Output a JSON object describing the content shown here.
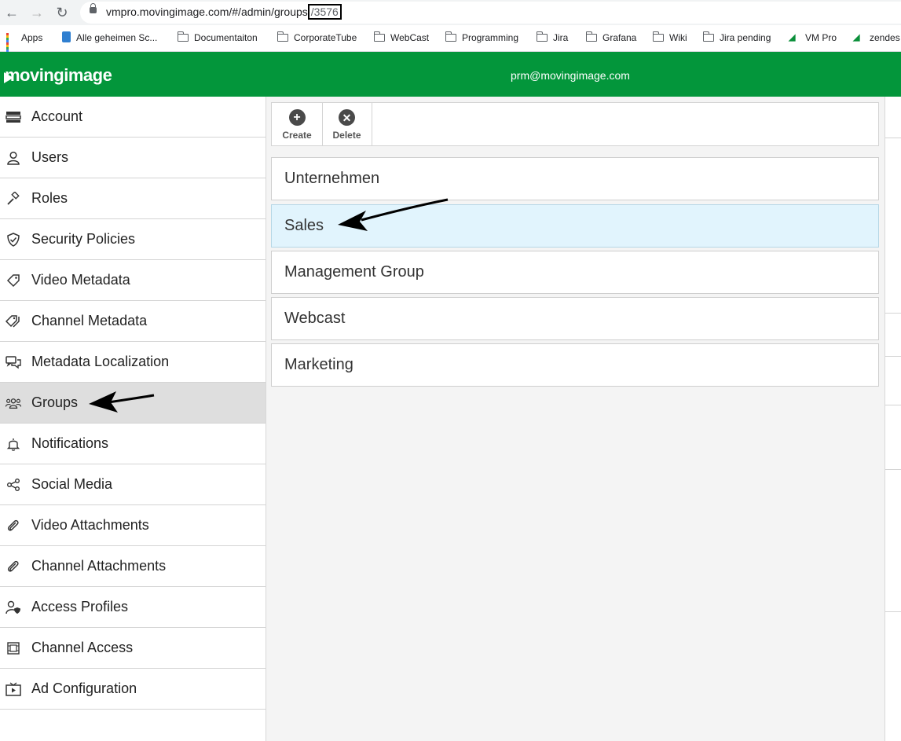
{
  "browser": {
    "url_prefix": "vmpro.movingimage.com/#/admin/groups",
    "url_id": "/3576",
    "bookmarks": [
      {
        "label": "Apps",
        "icon": "apps-grid-icon"
      },
      {
        "label": "Alle geheimen Sc...",
        "icon": "lock-icon"
      },
      {
        "label": "Documentaiton",
        "icon": "folder-icon"
      },
      {
        "label": "CorporateTube",
        "icon": "folder-icon"
      },
      {
        "label": "WebCast",
        "icon": "folder-icon"
      },
      {
        "label": "Programming",
        "icon": "folder-icon"
      },
      {
        "label": "Jira",
        "icon": "folder-icon"
      },
      {
        "label": "Grafana",
        "icon": "folder-icon"
      },
      {
        "label": "Wiki",
        "icon": "folder-icon"
      },
      {
        "label": "Jira pending",
        "icon": "folder-icon"
      },
      {
        "label": "VM Pro",
        "icon": "vmpro-icon"
      },
      {
        "label": "zendes",
        "icon": "vmpro-icon"
      }
    ]
  },
  "header": {
    "logo_text": "movingimage",
    "user_email": "prm@movingimage.com",
    "brand_color": "#03963b"
  },
  "sidebar": {
    "items": [
      {
        "label": "Account",
        "icon": "server-icon"
      },
      {
        "label": "Users",
        "icon": "user-icon"
      },
      {
        "label": "Roles",
        "icon": "gavel-icon"
      },
      {
        "label": "Security Policies",
        "icon": "shield-icon"
      },
      {
        "label": "Video Metadata",
        "icon": "tag-icon"
      },
      {
        "label": "Channel Metadata",
        "icon": "tags-icon"
      },
      {
        "label": "Metadata Localization",
        "icon": "comments-icon"
      },
      {
        "label": "Groups",
        "icon": "group-icon",
        "active": true
      },
      {
        "label": "Notifications",
        "icon": "bell-icon"
      },
      {
        "label": "Social Media",
        "icon": "share-icon"
      },
      {
        "label": "Video Attachments",
        "icon": "paperclip-icon"
      },
      {
        "label": "Channel Attachments",
        "icon": "paperclip-icon"
      },
      {
        "label": "Access Profiles",
        "icon": "user-shield-icon"
      },
      {
        "label": "Channel Access",
        "icon": "film-icon"
      },
      {
        "label": "Ad Configuration",
        "icon": "tv-play-icon"
      }
    ]
  },
  "toolbar": {
    "create_label": "Create",
    "delete_label": "Delete"
  },
  "groups": [
    {
      "name": "Unternehmen"
    },
    {
      "name": "Sales",
      "selected": true
    },
    {
      "name": "Management Group"
    },
    {
      "name": "Webcast"
    },
    {
      "name": "Marketing"
    }
  ]
}
